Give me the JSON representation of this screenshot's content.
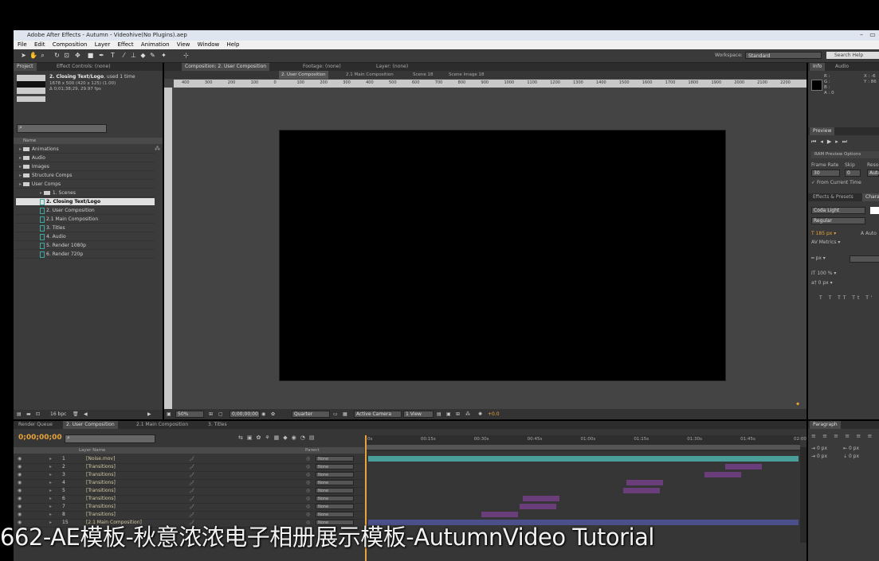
{
  "app": {
    "window_title": "Adobe After Effects - Autumn - Videohive(No Plugins).aep"
  },
  "menu": [
    "File",
    "Edit",
    "Composition",
    "Layer",
    "Effect",
    "Animation",
    "View",
    "Window",
    "Help"
  ],
  "toolbar": {
    "workspace_label": "Workspace:",
    "workspace_value": "Standard",
    "search_placeholder": "Search Help"
  },
  "project_panel": {
    "tabs": [
      "Project",
      "Effect Controls: (none)"
    ],
    "selected_name": "2. Closing Text/Logo",
    "selected_used": ", used 1 time",
    "selected_info1": "1678 x 500  (420 x 125) (1.00)",
    "selected_info2": "Δ 0;01;38;29, 29.97 fps",
    "column_name": "Name",
    "items": [
      {
        "label": "Animations",
        "type": "folder",
        "indent": 0
      },
      {
        "label": "Audio",
        "type": "folder",
        "indent": 0
      },
      {
        "label": "Images",
        "type": "folder",
        "indent": 0
      },
      {
        "label": "Structure Comps",
        "type": "folder",
        "indent": 0
      },
      {
        "label": "User Comps",
        "type": "folder",
        "indent": 0
      },
      {
        "label": "1. Scenes",
        "type": "folder",
        "indent": 1
      },
      {
        "label": "2. Closing Text/Logo",
        "type": "comp",
        "indent": 1,
        "selected": true
      },
      {
        "label": "2. User Composition",
        "type": "comp",
        "indent": 1
      },
      {
        "label": "2.1 Main Composition",
        "type": "comp",
        "indent": 1
      },
      {
        "label": "3. Titles",
        "type": "comp",
        "indent": 1
      },
      {
        "label": "4. Audio",
        "type": "comp",
        "indent": 1
      },
      {
        "label": "5. Render 1080p",
        "type": "comp",
        "indent": 1
      },
      {
        "label": "6. Render 720p",
        "type": "comp",
        "indent": 1
      }
    ],
    "bpc": "16 bpc"
  },
  "comp_panel": {
    "tabs": [
      "Composition: 2. User Composition",
      "Footage: (none)",
      "Layer: (none)"
    ],
    "breadcrumbs": [
      "2. User Composition",
      "2.1 Main Composition",
      "Scene 18",
      "Scene Image 18"
    ],
    "ruler_ticks": [
      "400",
      "300",
      "200",
      "100",
      "0",
      "100",
      "200",
      "300",
      "400",
      "500",
      "600",
      "700",
      "800",
      "900",
      "1000",
      "1100",
      "1200",
      "1300",
      "1400",
      "1500",
      "1600",
      "1700",
      "1800",
      "1900",
      "2000",
      "2100",
      "2200"
    ],
    "zoom": "50%",
    "timecode": "0;00;00;00",
    "resolution": "Quarter",
    "camera": "Active Camera",
    "view": "1 View",
    "exposure": "+0.0"
  },
  "timeline": {
    "tabs": [
      "Render Queue",
      "2. User Composition",
      "2.1 Main Composition",
      "3. Titles"
    ],
    "timecode": "0;00;00;00",
    "column_layer_name": "Layer Name",
    "column_parent": "Parent",
    "time_ticks": [
      "0s",
      "00:15s",
      "00:30s",
      "00:45s",
      "01:00s",
      "01:15s",
      "01:30s",
      "01:45s",
      "02:00"
    ],
    "layers": [
      {
        "num": "1",
        "name": "[Noise.mov]",
        "parent": "None"
      },
      {
        "num": "2",
        "name": "[Transitions]",
        "parent": "None"
      },
      {
        "num": "3",
        "name": "[Transitions]",
        "parent": "None"
      },
      {
        "num": "4",
        "name": "[Transitions]",
        "parent": "None"
      },
      {
        "num": "5",
        "name": "[Transitions]",
        "parent": "None"
      },
      {
        "num": "6",
        "name": "[Transitions]",
        "parent": "None"
      },
      {
        "num": "7",
        "name": "[Transitions]",
        "parent": "None"
      },
      {
        "num": "8",
        "name": "[Transitions]",
        "parent": "None"
      },
      {
        "num": "15",
        "name": "[2.1 Main Composition]",
        "parent": "None"
      }
    ]
  },
  "right_panels": {
    "info_tabs": [
      "Info",
      "Audio"
    ],
    "info_values": [
      "R :",
      "G :",
      "B :",
      "A : 0"
    ],
    "info_xy": [
      "X : -6",
      "Y : 86"
    ],
    "preview_tab": "Preview",
    "ram_preview": "RAM Preview Options",
    "frame_rate_label": "Frame Rate",
    "skip_label": "Skip",
    "resolution_label": "Reso",
    "frame_rate_value": "30",
    "skip_value": "0",
    "resolution_value": "Auto",
    "from_current_time": "From Current Time",
    "effects_tab": "Effects & Presets",
    "character_tab": "Chara",
    "font_name": "Coda Light",
    "font_style": "Regular",
    "font_size": "185 px",
    "leading": "Auto",
    "tracking_label": "Metrics",
    "stroke_unit": "px",
    "scale_v": "100 %",
    "baseline": "0 px",
    "paragraph_tab": "Paragraph",
    "para_values": [
      "0 px",
      "0 px",
      "0 px",
      "0 px"
    ]
  },
  "subtitle": "662-AE模板-秋意浓浓电子相册展示模板-AutumnVideo Tutorial",
  "colors": {
    "accent_orange": "#e8a33a",
    "layer_bar_teal": "#4a9e9a",
    "layer_bar_purple": "#6a3e7a"
  }
}
